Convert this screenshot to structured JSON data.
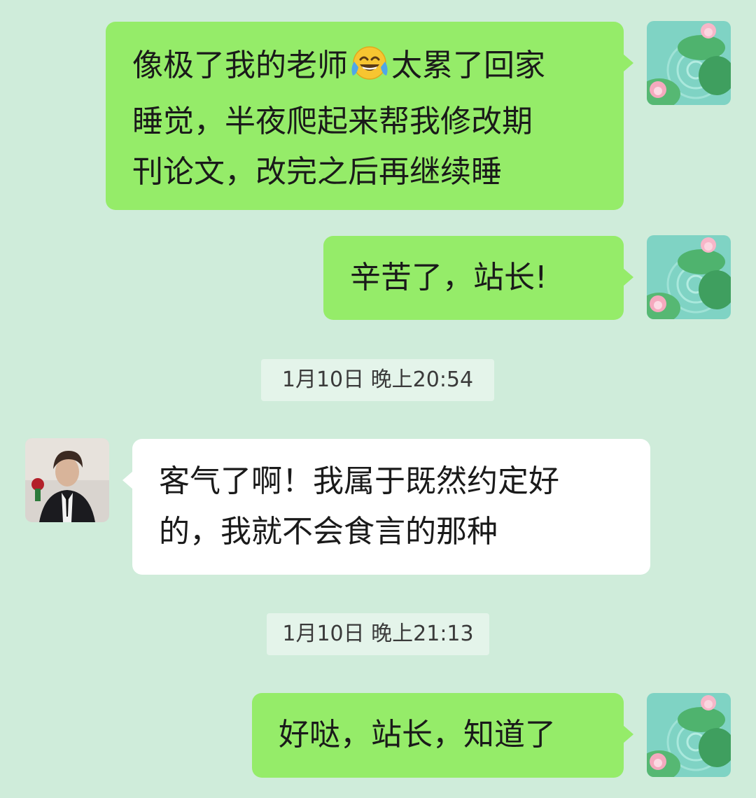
{
  "messages": [
    {
      "sender": "self",
      "lines": [
        "像极了我的老师",
        "太累了回家",
        "睡觉，半夜爬起来帮我修改期",
        "刊论文，改完之后再继续睡"
      ],
      "emoji": "face-with-tears-of-joy-emoji"
    },
    {
      "sender": "self",
      "text": "辛苦了，站长!"
    },
    {
      "sender": "other",
      "lines": [
        "客气了啊！我属于既然约定好",
        "的，我就不会食言的那种"
      ]
    },
    {
      "sender": "self",
      "text": "好哒，站长，知道了"
    }
  ],
  "timestamps": [
    "1月10日 晚上20:54",
    "1月10日 晚上21:13"
  ],
  "avatars": {
    "self": "lotus-pond-avatar",
    "other": "man-in-suit-avatar"
  },
  "colors": {
    "background": "#cfecda",
    "self_bubble": "#95ec69",
    "other_bubble": "#ffffff",
    "timestamp_bg": "#e4f4ea"
  }
}
